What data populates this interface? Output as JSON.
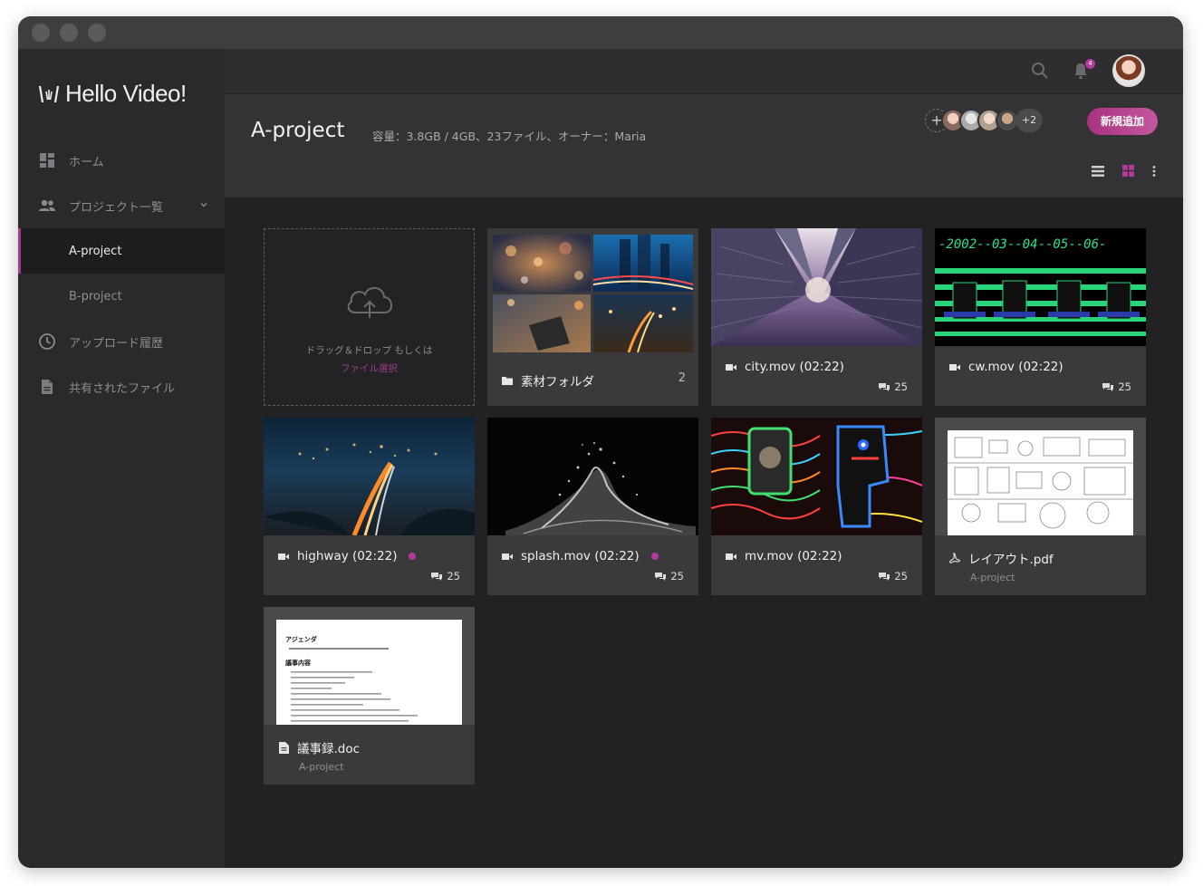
{
  "app": {
    "logo_text": "Hello Video!"
  },
  "sidebar": {
    "items": [
      {
        "label": "ホーム",
        "icon": "dashboard-icon"
      },
      {
        "label": "プロジェクト一覧",
        "icon": "people-icon"
      },
      {
        "label": "A-project",
        "active": true
      },
      {
        "label": "B-project"
      },
      {
        "label": "アップロード履歴",
        "icon": "clock-icon"
      },
      {
        "label": "共有されたファイル",
        "icon": "file-icon"
      }
    ]
  },
  "topbar": {
    "notification_count": "4"
  },
  "header": {
    "title": "A-project",
    "meta": "容量：3.8GB / 4GB、23ファイル、オーナー：Maria",
    "members_more": "+2",
    "new_button": "新規追加"
  },
  "upload": {
    "line1": "ドラッグ＆ドロップ もしくは",
    "line2": "ファイル選択"
  },
  "cards": [
    {
      "title": "素材フォルダ",
      "count": "2",
      "icon": "folder-icon"
    },
    {
      "title": "city.mov (02:22)",
      "count": "25",
      "icon": "video-icon"
    },
    {
      "title": "cw.mov (02:22)",
      "count": "25",
      "icon": "video-icon"
    },
    {
      "title": "highway (02:22)",
      "count": "25",
      "icon": "video-icon",
      "dot": true
    },
    {
      "title": "splash.mov (02:22)",
      "count": "25",
      "icon": "video-icon",
      "dot": true
    },
    {
      "title": "mv.mov (02:22)",
      "count": "25",
      "icon": "video-icon"
    },
    {
      "title": "レイアウト.pdf",
      "sub": "A-project",
      "icon": "pdf-icon"
    },
    {
      "title": "議事録.doc",
      "sub": "A-project",
      "icon": "doc-icon"
    }
  ],
  "thumb_texts": {
    "cw_counter": "-2002--03--04--05--06-",
    "doc_heading": "アジェンダ",
    "doc_section": "議事内容"
  },
  "colors": {
    "accent": "#b13a9a",
    "background": "#222224",
    "sidebar": "#2a2a2c"
  }
}
